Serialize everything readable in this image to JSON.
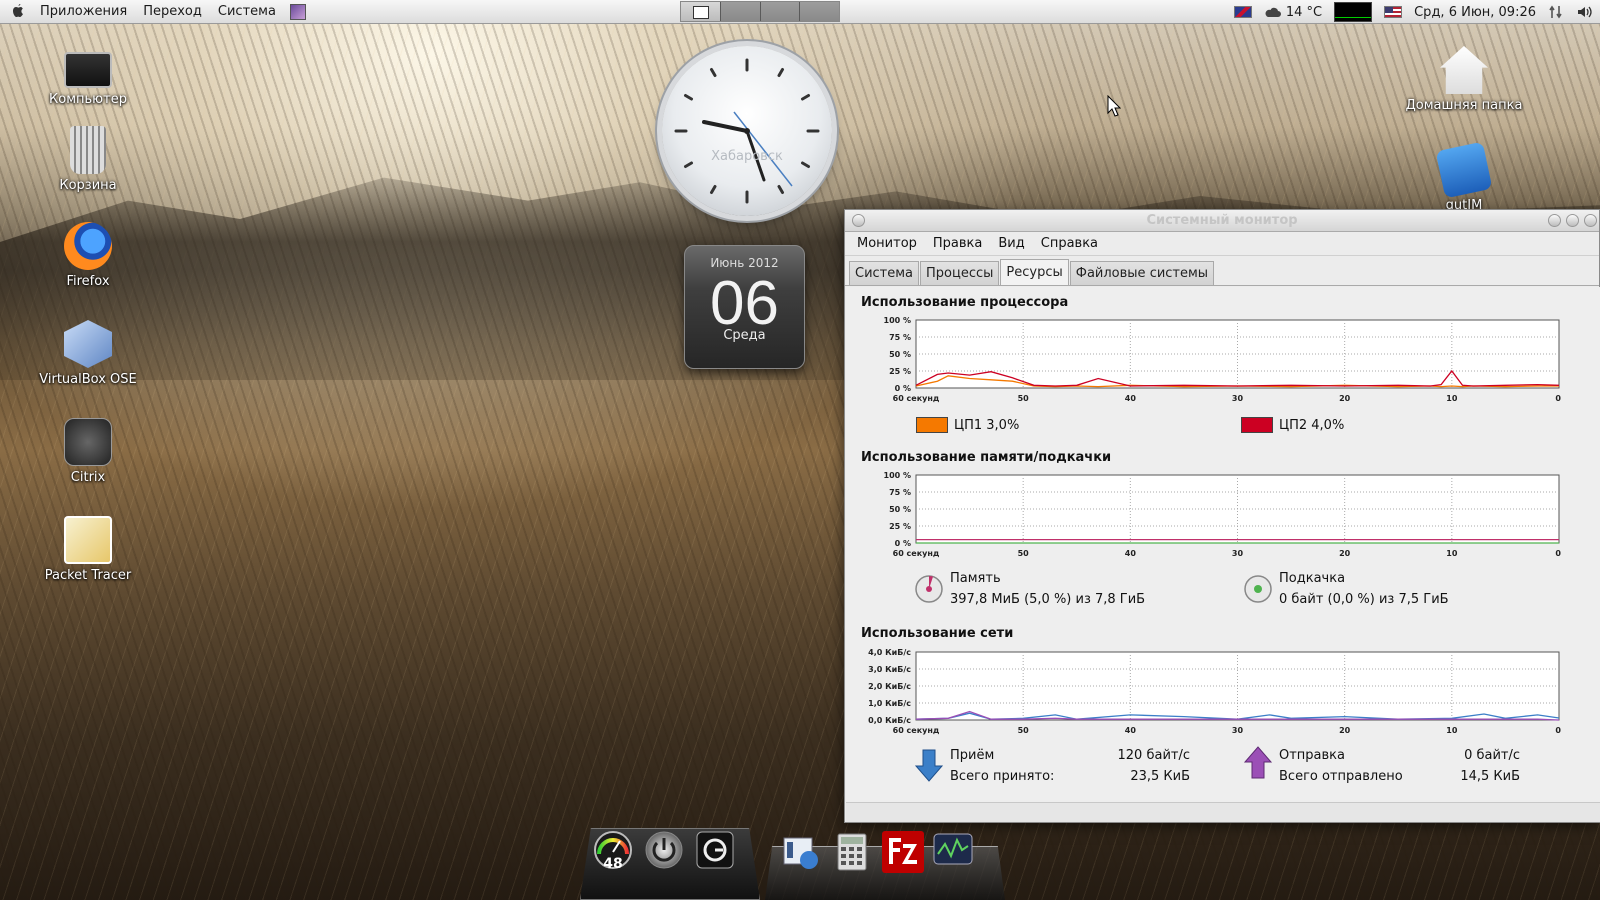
{
  "top_panel": {
    "menus": [
      "Приложения",
      "Переход",
      "Система"
    ],
    "weather": "14 °C",
    "datetime": "Срд,  6 Июн, 09:26"
  },
  "desktop_icons_left": [
    {
      "label": "Компьютер",
      "icon": "computer-icon"
    },
    {
      "label": "Корзина",
      "icon": "trash-icon"
    },
    {
      "label": "Firefox",
      "icon": "firefox-icon"
    },
    {
      "label": "VirtualBox OSE",
      "icon": "virtualbox-icon"
    },
    {
      "label": "Citrix",
      "icon": "citrix-icon"
    },
    {
      "label": "Packet Tracer",
      "icon": "packet-tracer-icon"
    }
  ],
  "desktop_icons_right": [
    {
      "label": "Домашняя папка",
      "icon": "home-folder-icon"
    },
    {
      "label": "qutIM",
      "icon": "qutim-icon"
    }
  ],
  "clock": {
    "city": "Хабаровск",
    "time_shown": "09:26"
  },
  "calendar": {
    "month": "Июнь 2012",
    "day": "06",
    "weekday": "Среда"
  },
  "window": {
    "title": "Системный монитор",
    "menu": [
      "Монитор",
      "Правка",
      "Вид",
      "Справка"
    ],
    "tabs": [
      "Система",
      "Процессы",
      "Ресурсы",
      "Файловые системы"
    ],
    "active_tab": "Ресурсы"
  },
  "resources": {
    "cpu": {
      "title": "Использование процессора",
      "y_ticks": [
        "100 %",
        "75 %",
        "50 %",
        "25 %",
        "0 %"
      ],
      "x_ticks": [
        "60 секунд",
        "50",
        "40",
        "30",
        "20",
        "10",
        "0"
      ],
      "legend": [
        {
          "name": "ЦП1",
          "value": "3,0%",
          "color": "#f57900"
        },
        {
          "name": "ЦП2",
          "value": "4,0%",
          "color": "#cc0022"
        }
      ]
    },
    "memory": {
      "title": "Использование памяти/подкачки",
      "y_ticks": [
        "100 %",
        "75 %",
        "50 %",
        "25 %",
        "0 %"
      ],
      "x_ticks": [
        "60 секунд",
        "50",
        "40",
        "30",
        "20",
        "10",
        "0"
      ],
      "mem_label": "Память",
      "mem_value": "397,8 МиБ (5,0 %) из 7,8 ГиБ",
      "swap_label": "Подкачка",
      "swap_value": "0 байт (0,0 %) из 7,5 ГиБ"
    },
    "network": {
      "title": "Использование сети",
      "y_ticks": [
        "4,0 КиБ/с",
        "3,0 КиБ/с",
        "2,0 КиБ/с",
        "1,0 КиБ/с",
        "0,0 КиБ/с"
      ],
      "x_ticks": [
        "60 секунд",
        "50",
        "40",
        "30",
        "20",
        "10",
        "0"
      ],
      "rx_label": "Приём",
      "rx_value": "120 байт/с",
      "rx_total_label": "Всего принято:",
      "rx_total_value": "23,5 КиБ",
      "tx_label": "Отправка",
      "tx_value": "0 байт/с",
      "tx_total_label": "Всего отправлено",
      "tx_total_value": "14,5 КиБ"
    }
  },
  "chart_data": [
    {
      "type": "line",
      "title": "Использование процессора",
      "x": [
        60,
        58,
        57,
        55,
        53,
        51,
        49,
        47,
        45,
        43,
        40,
        35,
        30,
        25,
        20,
        15,
        12,
        11,
        10,
        9,
        8,
        5,
        2,
        0
      ],
      "series": [
        {
          "name": "ЦП1",
          "values": [
            3,
            10,
            18,
            14,
            12,
            10,
            3,
            2,
            3,
            2,
            4,
            2,
            3,
            2,
            4,
            2,
            3,
            2,
            3,
            2,
            3,
            2,
            3,
            3
          ]
        },
        {
          "name": "ЦП2",
          "values": [
            4,
            20,
            22,
            19,
            24,
            15,
            4,
            3,
            4,
            14,
            3,
            4,
            3,
            4,
            3,
            4,
            3,
            5,
            25,
            4,
            3,
            4,
            5,
            4
          ]
        }
      ],
      "ylim": [
        0,
        100
      ]
    },
    {
      "type": "line",
      "title": "Использование памяти/подкачки",
      "x": [
        60,
        0
      ],
      "series": [
        {
          "name": "Память",
          "values": [
            5.0,
            5.0
          ]
        },
        {
          "name": "Подкачка",
          "values": [
            0.0,
            0.0
          ]
        }
      ],
      "ylim": [
        0,
        100
      ]
    },
    {
      "type": "line",
      "title": "Использование сети",
      "x": [
        60,
        57,
        55,
        53,
        50,
        47,
        45,
        40,
        35,
        30,
        27,
        25,
        20,
        15,
        10,
        7,
        5,
        2,
        0
      ],
      "series": [
        {
          "name": "Приём",
          "values": [
            0.05,
            0.1,
            0.4,
            0.05,
            0.1,
            0.3,
            0.05,
            0.3,
            0.2,
            0.05,
            0.3,
            0.1,
            0.2,
            0.05,
            0.1,
            0.35,
            0.1,
            0.3,
            0.12
          ]
        },
        {
          "name": "Отправка",
          "values": [
            0.05,
            0.1,
            0.5,
            0.05,
            0.05,
            0.1,
            0.05,
            0.05,
            0.05,
            0.05,
            0.05,
            0.05,
            0.05,
            0.05,
            0.05,
            0.05,
            0.05,
            0.05,
            0.0
          ]
        }
      ],
      "ylim": [
        0,
        4.0
      ]
    }
  ],
  "dock": {
    "gauge_value": "48"
  }
}
